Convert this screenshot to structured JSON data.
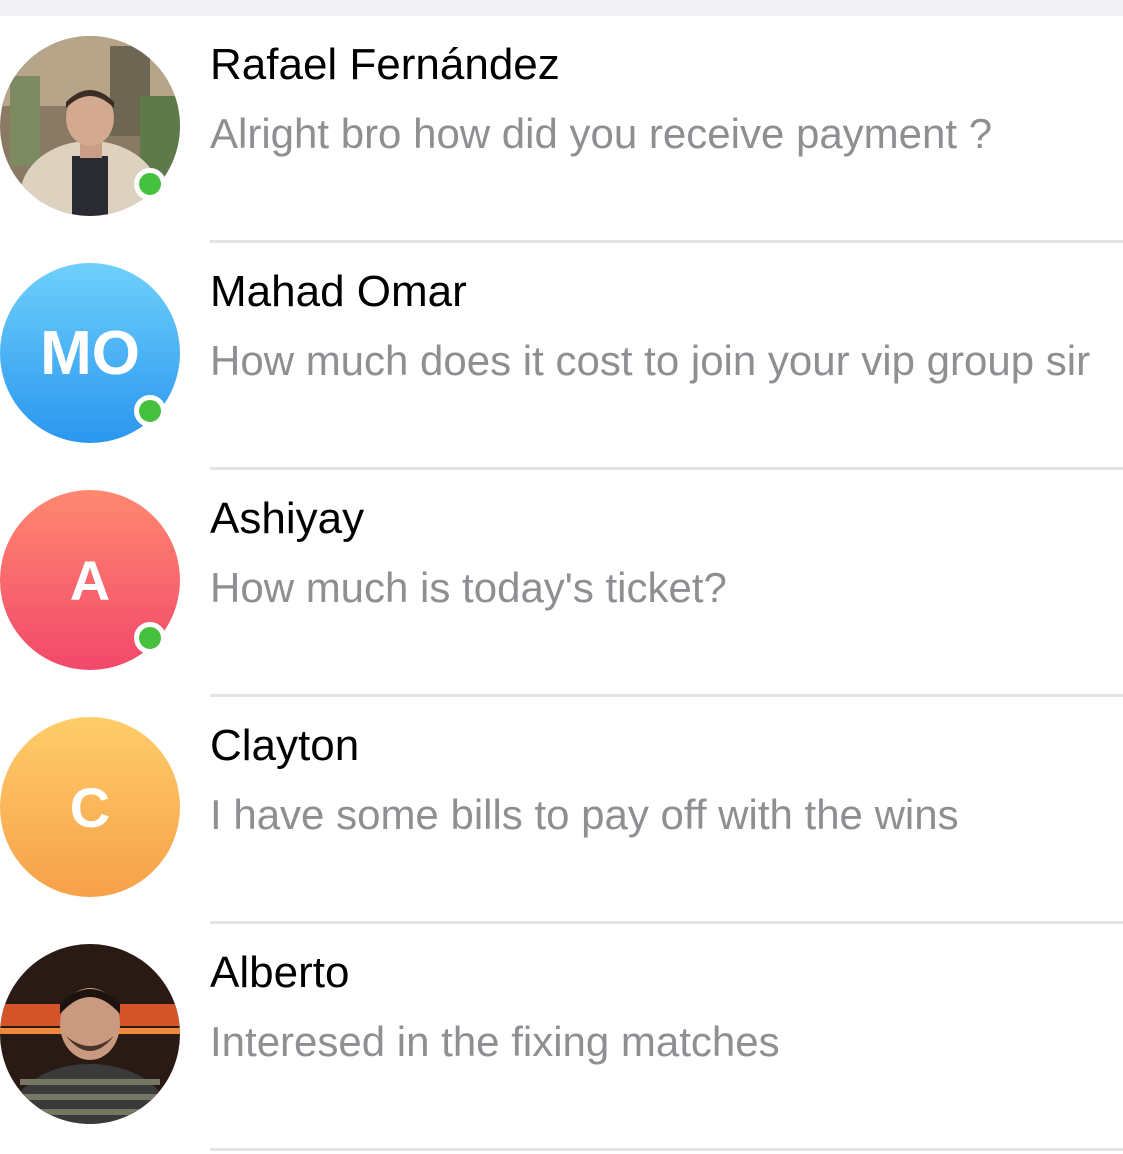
{
  "chats": [
    {
      "name": "Rafael Fernández",
      "message": "Alright bro how did you receive payment ?",
      "avatar": {
        "type": "photo",
        "icon": "person-photo"
      },
      "online": true
    },
    {
      "name": "Mahad Omar",
      "message": "How much does it cost to join your vip group sir",
      "avatar": {
        "type": "initials",
        "initials": "MO",
        "color": "#3aa7f2"
      },
      "online": true
    },
    {
      "name": "Ashiyay",
      "message": "How much is today's ticket?",
      "avatar": {
        "type": "initials",
        "initials": "A",
        "color": "#f65c6a"
      },
      "online": true
    },
    {
      "name": "Clayton",
      "message": "I have some bills to pay off with the wins",
      "avatar": {
        "type": "initials",
        "initials": "C",
        "color": "#fbb85a"
      },
      "online": false
    },
    {
      "name": "Alberto",
      "message": "Interesed in the fixing matches",
      "avatar": {
        "type": "photo",
        "icon": "person-photo"
      },
      "online": false
    }
  ],
  "colors": {
    "online": "#46c13f",
    "separator": "#e4e4e8",
    "preview_text": "#8e8e93"
  }
}
